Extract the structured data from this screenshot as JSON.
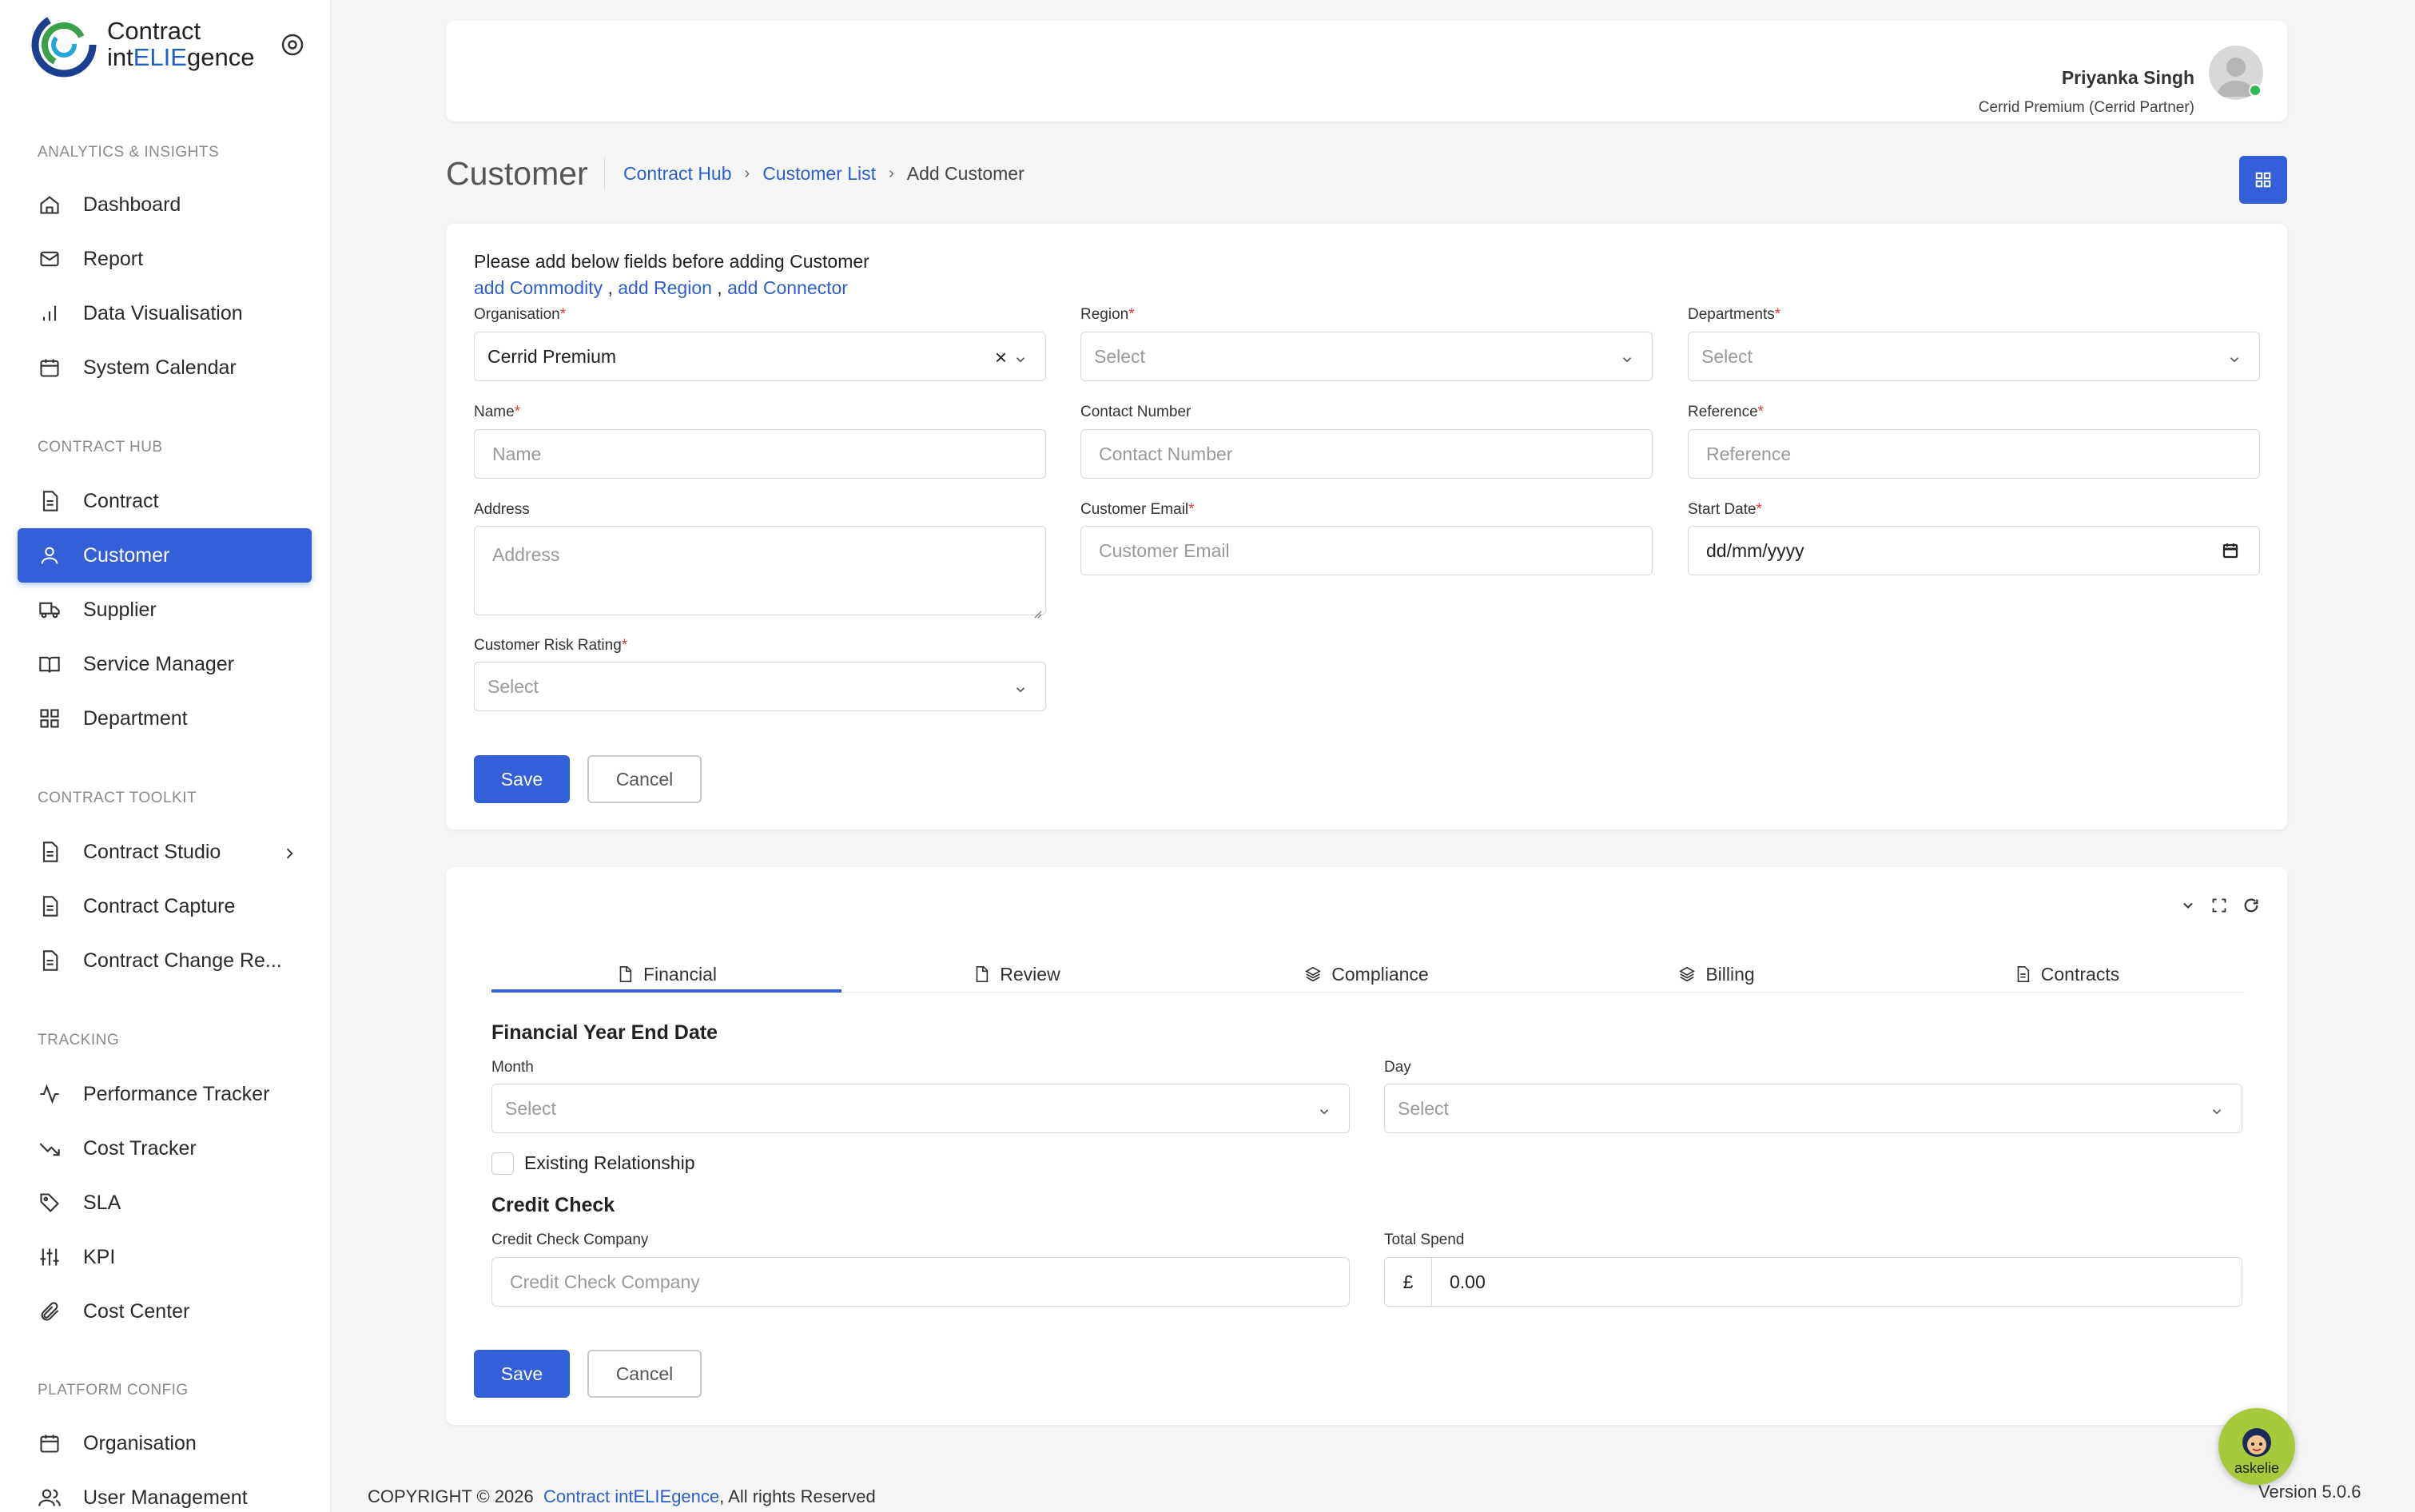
{
  "app": {
    "logo_line1": "Contract",
    "logo_line2_pre": "int",
    "logo_line2_eli": "ELIE",
    "logo_line2_post": "gence"
  },
  "sidebar": {
    "sections": [
      {
        "title": "ANALYTICS & INSIGHTS",
        "items": [
          {
            "label": "Dashboard",
            "icon": "home-icon"
          },
          {
            "label": "Report",
            "icon": "mail-icon"
          },
          {
            "label": "Data Visualisation",
            "icon": "bar-chart-icon"
          },
          {
            "label": "System Calendar",
            "icon": "calendar-icon"
          }
        ]
      },
      {
        "title": "CONTRACT HUB",
        "items": [
          {
            "label": "Contract",
            "icon": "document-icon"
          },
          {
            "label": "Customer",
            "icon": "user-icon",
            "active": true
          },
          {
            "label": "Supplier",
            "icon": "truck-icon"
          },
          {
            "label": "Service Manager",
            "icon": "book-icon"
          },
          {
            "label": "Department",
            "icon": "grid-icon"
          }
        ]
      },
      {
        "title": "CONTRACT TOOLKIT",
        "items": [
          {
            "label": "Contract Studio",
            "icon": "document-icon",
            "has_children": true
          },
          {
            "label": "Contract Capture",
            "icon": "document-icon"
          },
          {
            "label": "Contract Change Re...",
            "icon": "document-icon"
          }
        ]
      },
      {
        "title": "TRACKING",
        "items": [
          {
            "label": "Performance Tracker",
            "icon": "activity-icon"
          },
          {
            "label": "Cost Tracker",
            "icon": "trending-down-icon"
          },
          {
            "label": "SLA",
            "icon": "tag-icon"
          },
          {
            "label": "KPI",
            "icon": "sliders-icon"
          },
          {
            "label": "Cost Center",
            "icon": "paperclip-icon"
          }
        ]
      },
      {
        "title": "PLATFORM CONFIG",
        "items": [
          {
            "label": "Organisation",
            "icon": "calendar-icon"
          },
          {
            "label": "User Management",
            "icon": "users-icon"
          }
        ]
      }
    ]
  },
  "header": {
    "user_name": "Priyanka Singh",
    "user_role": "Cerrid Premium (Cerrid Partner)"
  },
  "page": {
    "title": "Customer",
    "breadcrumb": [
      "Contract Hub",
      "Customer List",
      "Add Customer"
    ]
  },
  "form": {
    "note": "Please add below fields before adding Customer",
    "links": {
      "commodity": "add Commodity",
      "region": "add Region",
      "connector": "add Connector",
      "sep": " , "
    },
    "organisation": {
      "label": "Organisation",
      "value": "Cerrid Premium"
    },
    "region": {
      "label": "Region",
      "placeholder": "Select"
    },
    "departments": {
      "label": "Departments",
      "placeholder": "Select"
    },
    "name": {
      "label": "Name",
      "placeholder": "Name"
    },
    "contact_number": {
      "label": "Contact Number",
      "placeholder": "Contact Number"
    },
    "reference": {
      "label": "Reference",
      "placeholder": "Reference"
    },
    "address": {
      "label": "Address",
      "placeholder": "Address"
    },
    "customer_email": {
      "label": "Customer Email",
      "placeholder": "Customer Email"
    },
    "start_date": {
      "label": "Start Date",
      "value": "dd/mm/yyyy"
    },
    "risk_rating": {
      "label": "Customer Risk Rating",
      "placeholder": "Select"
    },
    "required_mark": "*",
    "save": "Save",
    "cancel": "Cancel"
  },
  "tabs": {
    "items": [
      {
        "label": "Financial",
        "icon": "file-icon",
        "active": true
      },
      {
        "label": "Review",
        "icon": "file-icon"
      },
      {
        "label": "Compliance",
        "icon": "layers-icon"
      },
      {
        "label": "Billing",
        "icon": "layers-icon"
      },
      {
        "label": "Contracts",
        "icon": "document-icon"
      }
    ]
  },
  "financial": {
    "fy_heading": "Financial Year End Date",
    "month": {
      "label": "Month",
      "placeholder": "Select"
    },
    "day": {
      "label": "Day",
      "placeholder": "Select"
    },
    "existing_relationship": "Existing Relationship",
    "credit_heading": "Credit Check",
    "credit_company": {
      "label": "Credit Check Company",
      "placeholder": "Credit Check Company"
    },
    "total_spend": {
      "label": "Total Spend",
      "currency": "£",
      "value": "0.00"
    },
    "save": "Save",
    "cancel": "Cancel"
  },
  "footer": {
    "copyright": "COPYRIGHT © 2026",
    "brand": "Contract intELIEgence",
    "rights": ", All rights Reserved",
    "version": "Version 5.0.6"
  },
  "assistant": {
    "label": "askelie"
  },
  "colors": {
    "primary": "#3360d8",
    "link": "#2c5fcb",
    "required": "#e03b3b",
    "online": "#2dbb55",
    "assistant_bg": "#a5c93a"
  }
}
